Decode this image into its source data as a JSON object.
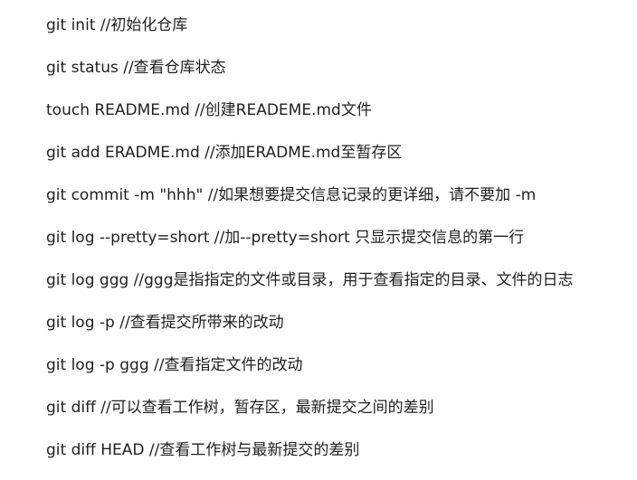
{
  "lines": [
    "git init //初始化仓库",
    "git status //查看仓库状态",
    "touch README.md //创建READEME.md文件",
    "git add ERADME.md //添加ERADME.md至暂存区",
    "git commit -m \"hhh\" //如果想要提交信息记录的更详细，请不要加 -m",
    "git log --pretty=short //加--pretty=short 只显示提交信息的第一行",
    "git log ggg //ggg是指指定的文件或目录，用于查看指定的目录、文件的日志",
    "git log -p //查看提交所带来的改动",
    "git log -p ggg //查看指定文件的改动",
    "git diff //可以查看工作树，暂存区，最新提交之间的差别",
    "git diff HEAD //查看工作树与最新提交的差别"
  ]
}
